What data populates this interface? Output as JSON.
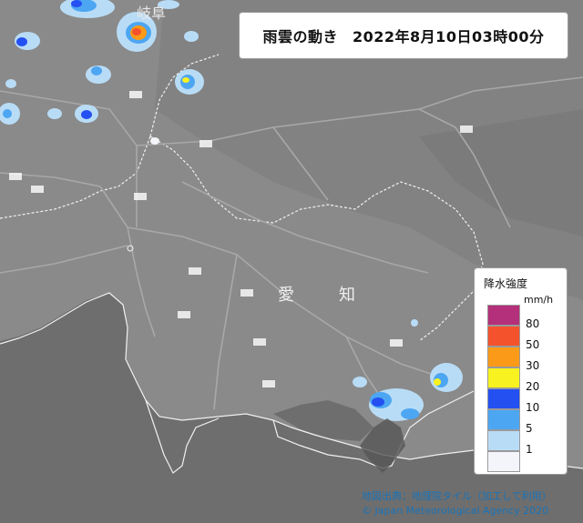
{
  "title": {
    "label": "雨雲の動き",
    "datetime": "2022年8月10日03時00分"
  },
  "legend": {
    "title": "降水強度",
    "unit": "mm/h",
    "levels": [
      {
        "label": "80",
        "color": "#b4307a"
      },
      {
        "label": "50",
        "color": "#f4522c"
      },
      {
        "label": "30",
        "color": "#fa9a18"
      },
      {
        "label": "20",
        "color": "#f8f220"
      },
      {
        "label": "10",
        "color": "#2450f2"
      },
      {
        "label": "5",
        "color": "#4da6f2"
      },
      {
        "label": "1",
        "color": "#b9dcf6"
      },
      {
        "label": "",
        "color": "#f4f4fb"
      }
    ]
  },
  "map_labels": {
    "gifu_fragment": "岐阜",
    "aichi_ai": "愛",
    "aichi_chi": "知"
  },
  "source": "地図出典：地理院タイル（加工して利用）",
  "copyright": "© Japan Meteorological Agency 2020",
  "colors": {
    "land": "#8a8a8a",
    "sea": "#6e6e6e",
    "border": "#f0f0f0"
  }
}
